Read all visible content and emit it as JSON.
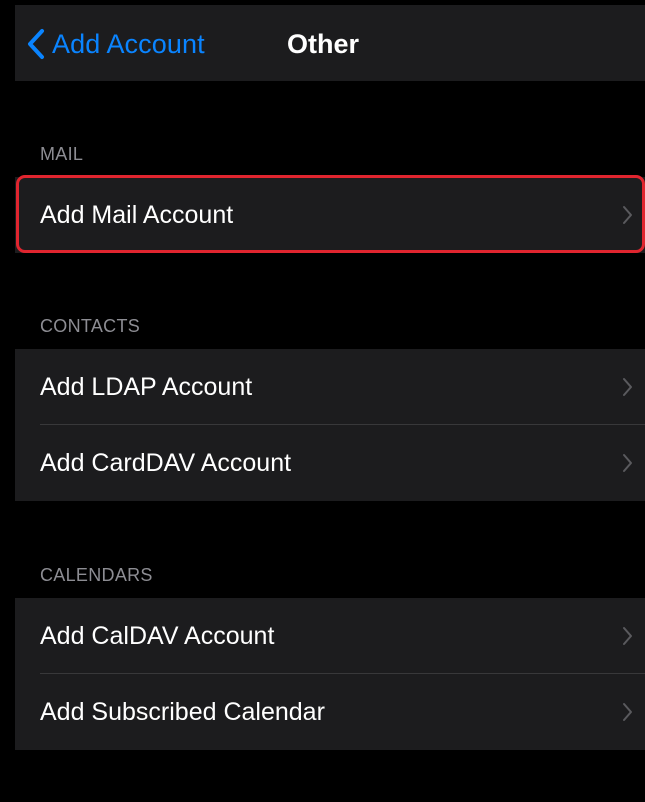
{
  "navbar": {
    "back_label": "Add Account",
    "title": "Other"
  },
  "sections": [
    {
      "header": "MAIL",
      "rows": [
        {
          "label": "Add Mail Account"
        }
      ]
    },
    {
      "header": "CONTACTS",
      "rows": [
        {
          "label": "Add LDAP Account"
        },
        {
          "label": "Add CardDAV Account"
        }
      ]
    },
    {
      "header": "CALENDARS",
      "rows": [
        {
          "label": "Add CalDAV Account"
        },
        {
          "label": "Add Subscribed Calendar"
        }
      ]
    }
  ],
  "colors": {
    "background": "#000000",
    "cell": "#1c1c1e",
    "accent": "#0a84ff",
    "header_text": "#8d8d93",
    "highlight": "#e0252f"
  },
  "icons": {
    "back": "chevron-left-icon",
    "disclosure": "chevron-right-icon"
  }
}
